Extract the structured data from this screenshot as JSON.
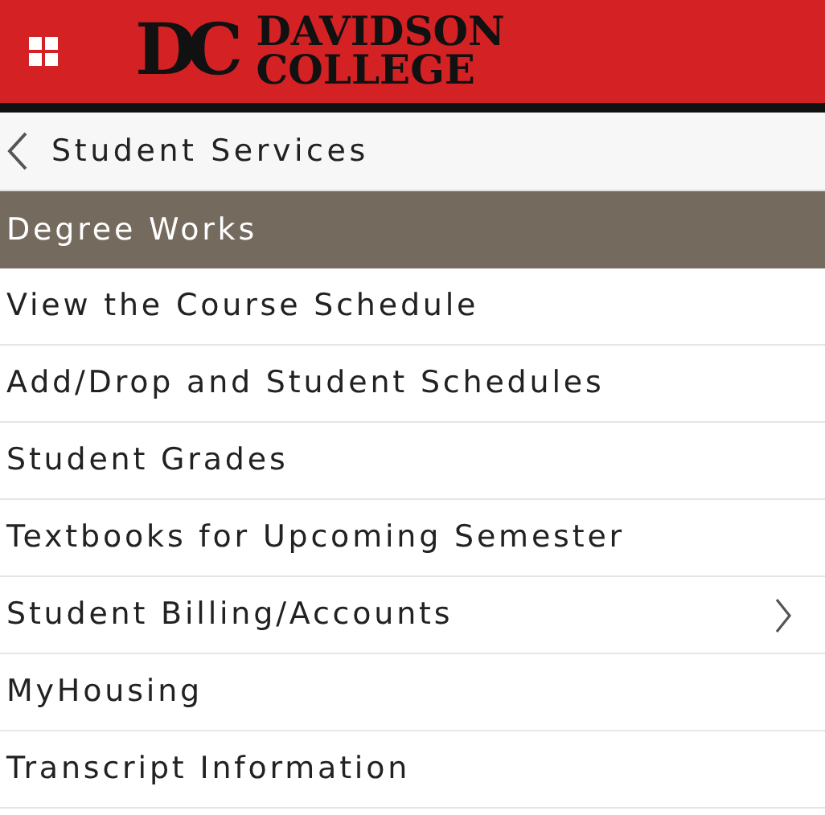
{
  "header": {
    "logo": {
      "monogram": "DC",
      "line1": "DAVIDSON",
      "line2": "COLLEGE"
    }
  },
  "back_bar": {
    "title": "Student Services"
  },
  "menu": [
    {
      "label": "Degree Works",
      "selected": true,
      "has_submenu": false
    },
    {
      "label": "View the Course Schedule",
      "selected": false,
      "has_submenu": false
    },
    {
      "label": "Add/Drop and Student Schedules",
      "selected": false,
      "has_submenu": false
    },
    {
      "label": "Student Grades",
      "selected": false,
      "has_submenu": false
    },
    {
      "label": "Textbooks for Upcoming Semester",
      "selected": false,
      "has_submenu": false
    },
    {
      "label": "Student Billing/Accounts",
      "selected": false,
      "has_submenu": true
    },
    {
      "label": "MyHousing",
      "selected": false,
      "has_submenu": false
    },
    {
      "label": "Transcript Information",
      "selected": false,
      "has_submenu": false
    }
  ]
}
